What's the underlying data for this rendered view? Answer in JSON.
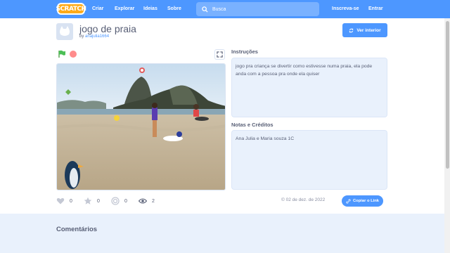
{
  "nav": {
    "logo": "SCRATCH",
    "links": [
      "Criar",
      "Explorar",
      "Ideias",
      "Sobre"
    ],
    "search_placeholder": "Busca",
    "join": "Inscreva-se",
    "signin": "Entrar",
    "color": "#4d97ff"
  },
  "project": {
    "title": "jogo de praia",
    "by_prefix": "by ",
    "author": "anajulia1664",
    "see_inside": "Ver interior"
  },
  "player": {
    "green_flag_icon": "green-flag-icon",
    "stop_icon": "stop-icon",
    "fullscreen_icon": "fullscreen-icon"
  },
  "instructions": {
    "label": "Instruções",
    "text": "jogo pra criança se divertir como estivesse numa praia, ela pode anda com a pessoa pra onde ela quiser"
  },
  "notes": {
    "label": "Notas e Créditos",
    "text": "Ana Julia e Maria souza 1C"
  },
  "stats": {
    "loves": "0",
    "favorites": "0",
    "remixes": "0",
    "views": "2"
  },
  "date": "02 de dez. de 2022",
  "copy_link": "Copiar o Link",
  "comments_title": "Comentários"
}
